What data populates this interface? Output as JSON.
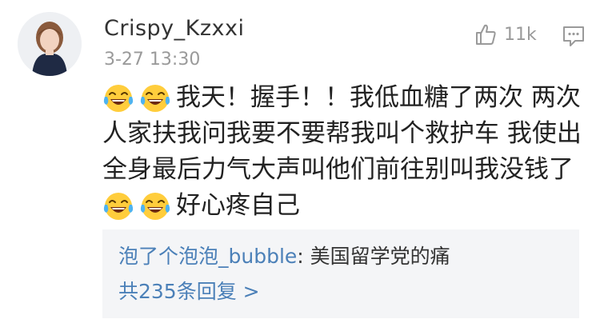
{
  "comment": {
    "username": "Crispy_Kzxxi",
    "timestamp": "3-27 13:30",
    "like_count": "11k",
    "lines": [
      {
        "emoji_before": 2,
        "text": "我天！握手！！我低血糖了两次 两次"
      },
      {
        "emoji_before": 0,
        "text": "人家扶我问我要不要帮我叫个救护车 我使出"
      },
      {
        "emoji_before": 0,
        "text": "全身最后力气大声叫他们前往别叫我没钱了"
      },
      {
        "emoji_before": 2,
        "text": "好心疼自己"
      }
    ],
    "emoji_name": "laughing-crying-emoji"
  },
  "reply_preview": {
    "author": "泡了个泡泡_bubble",
    "separator": ": ",
    "text": "美国留学党的痛",
    "count_label": "共235条回复 >"
  },
  "colors": {
    "link_blue": "#4b80b8",
    "muted_gray": "#9a9a9a",
    "reply_bg": "#f4f5f7",
    "emoji_yellow": "#ffcd3c"
  }
}
